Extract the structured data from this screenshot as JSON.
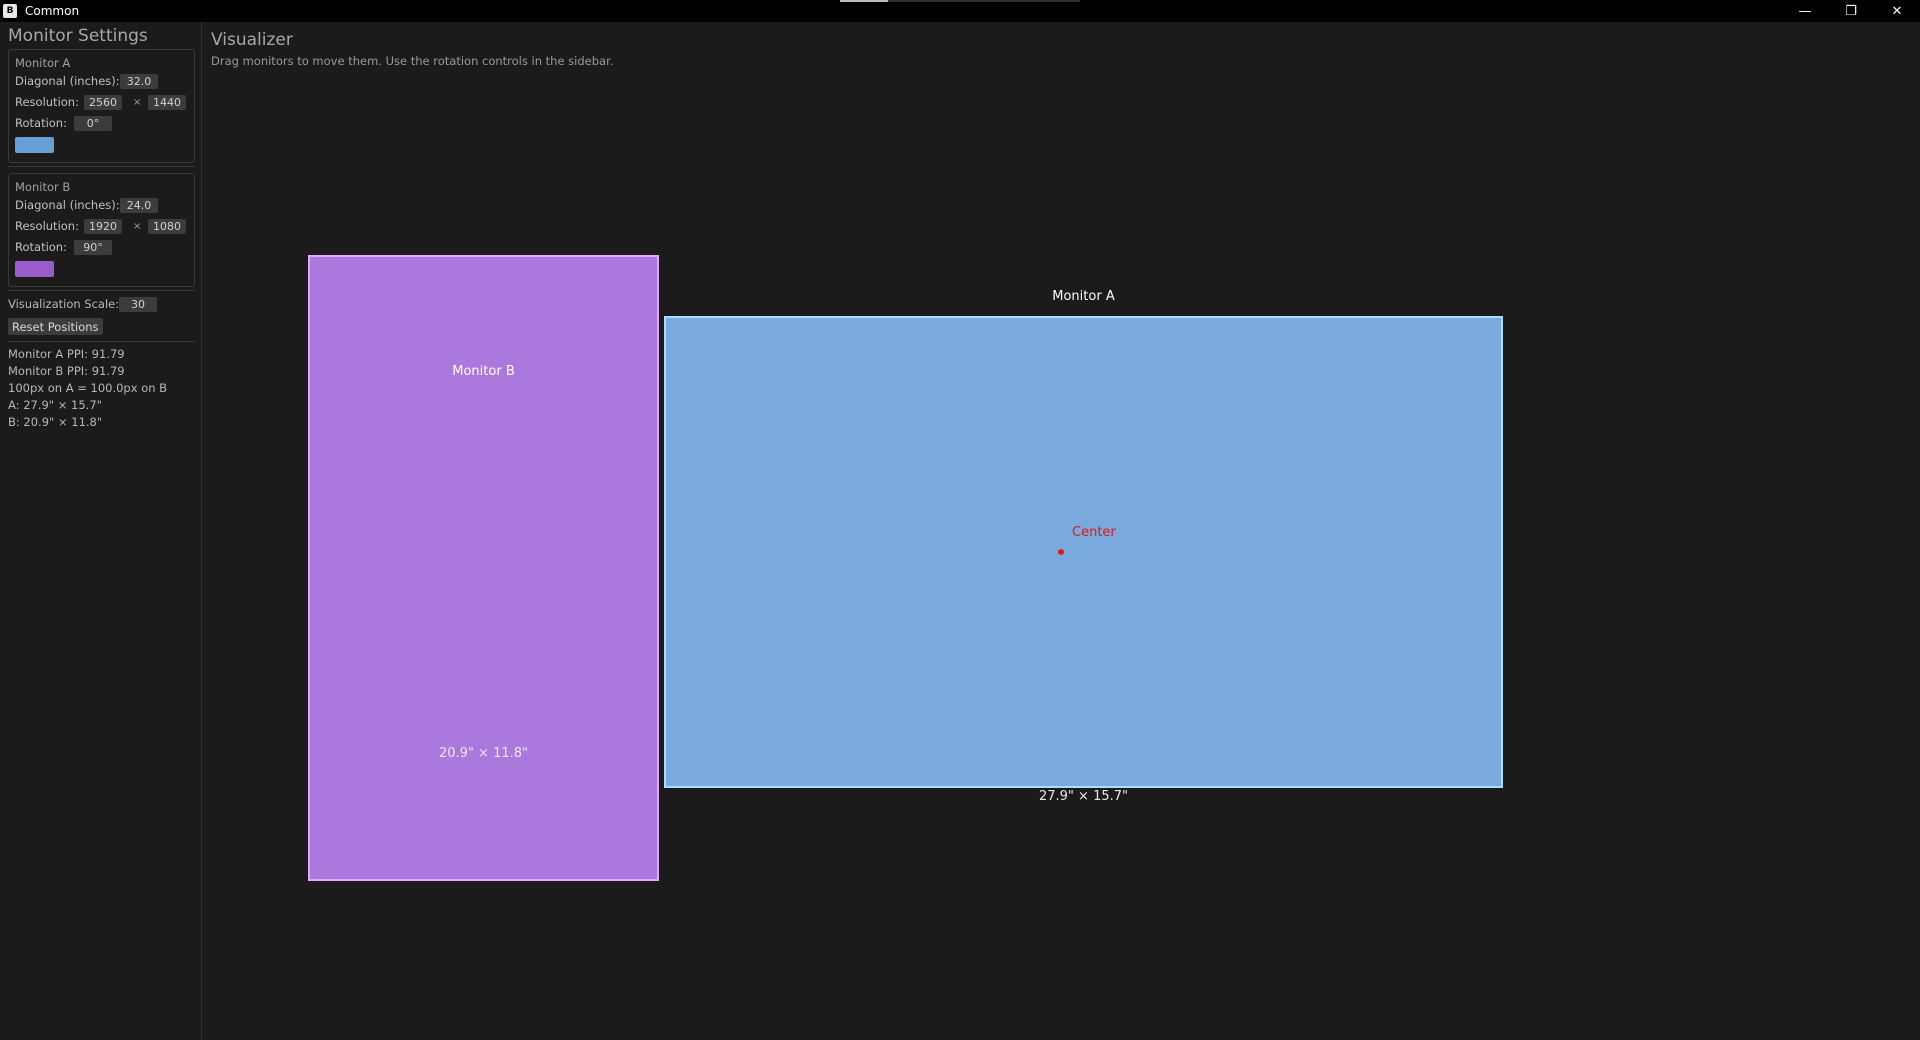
{
  "window": {
    "title": "Common",
    "icon_glyph": "B",
    "controls": {
      "minimize": "—",
      "restore": "❐",
      "close": "✕"
    }
  },
  "sidebar": {
    "title": "Monitor Settings",
    "monitor_a": {
      "title": "Monitor A",
      "diagonal_label": "Diagonal (inches):",
      "diagonal_value": "32.0",
      "resolution_label": "Resolution:",
      "res_w": "2560",
      "res_sep": "×",
      "res_h": "1440",
      "rotation_label": "Rotation:",
      "rotation_value": "0°",
      "color": "#6a9fd6"
    },
    "monitor_b": {
      "title": "Monitor B",
      "diagonal_label": "Diagonal (inches):",
      "diagonal_value": "24.0",
      "resolution_label": "Resolution:",
      "res_w": "1920",
      "res_sep": "×",
      "res_h": "1080",
      "rotation_label": "Rotation:",
      "rotation_value": "90°",
      "color": "#9a5ccc"
    },
    "scale_label": "Visualization Scale:",
    "scale_value": "30",
    "reset_button": "Reset Positions",
    "stats": [
      "Monitor A PPI: 91.79",
      "Monitor B PPI: 91.79",
      "100px on A = 100.0px on B",
      "A: 27.9\" × 15.7\"",
      "B: 20.9\" × 11.8\""
    ]
  },
  "main": {
    "title": "Visualizer",
    "subtitle": "Drag monitors to move them. Use the rotation controls in the sidebar.",
    "monitor_a": {
      "label": "Monitor A",
      "dimensions": "27.9\" × 15.7\""
    },
    "monitor_b": {
      "label": "Monitor B",
      "dimensions": "20.9\" × 11.8\""
    },
    "center_label": "Center"
  }
}
